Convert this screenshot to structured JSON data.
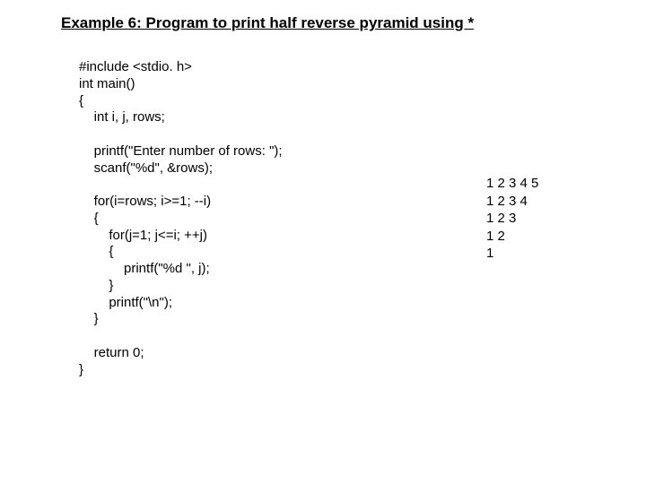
{
  "title": "Example 6: Program to print half reverse pyramid using *",
  "code": {
    "l1": "#include <stdio. h>",
    "l2": "int main()",
    "l3": "{",
    "l4": "    int i, j, rows;",
    "blank1": "",
    "l5": "    printf(\"Enter number of rows: \");",
    "l6": "    scanf(\"%d\", &rows);",
    "blank2": "",
    "l7": "    for(i=rows; i>=1; --i)",
    "l8": "    {",
    "l9": "        for(j=1; j<=i; ++j)",
    "l10": "        {",
    "l11": "            printf(\"%d \", j);",
    "l12": "        }",
    "l13": "        printf(\"\\n\");",
    "l14": "    }",
    "blank3": "",
    "l15": "    return 0;",
    "l16": "}"
  },
  "output": {
    "r1": "1 2 3 4 5",
    "r2": "1 2 3 4",
    "r3": "1 2 3",
    "r4": "1 2",
    "r5": "1"
  }
}
